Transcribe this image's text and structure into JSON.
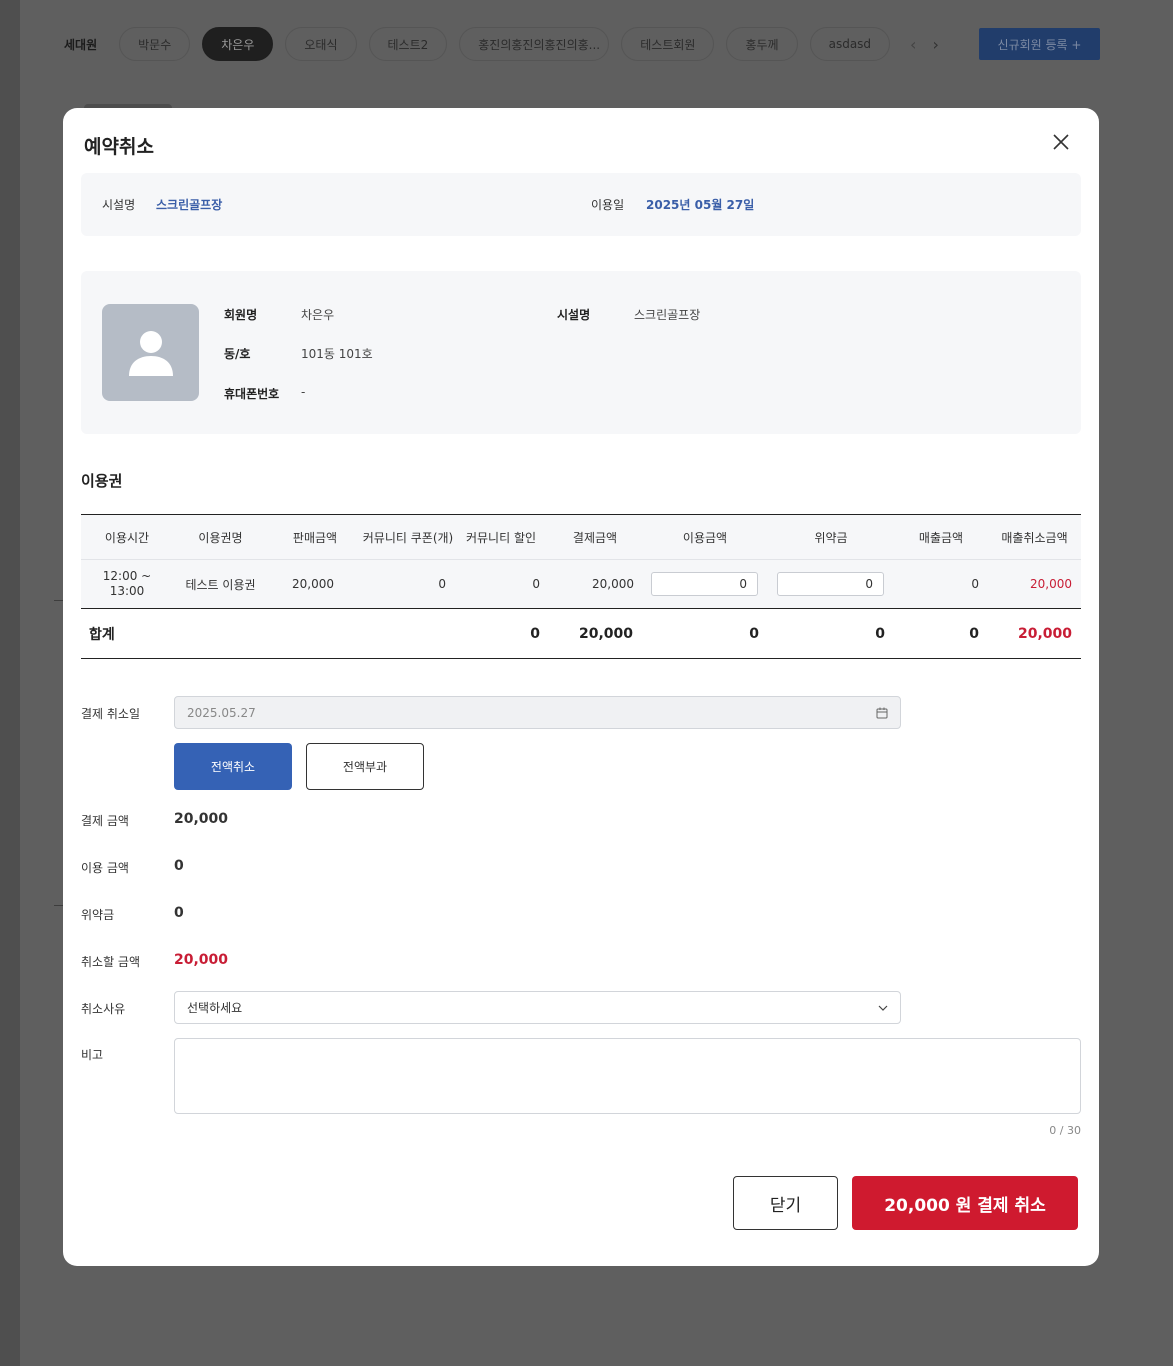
{
  "background": {
    "member_bar_label": "세대원",
    "members": [
      "박문수",
      "차은우",
      "오태식",
      "테스트2",
      "홍진의홍진의홍진의홍...",
      "테스트회원",
      "홍두께",
      "asdasd"
    ],
    "active_member_index": 1,
    "new_member_button": "신규회원 등록  +"
  },
  "modal": {
    "title": "예약취소",
    "info": {
      "facility_label": "시설명",
      "facility_value": "스크린골프장",
      "date_label": "이용일",
      "date_value": "2025년 05월 27일"
    },
    "member": {
      "name_label": "회원명",
      "name_value": "차은우",
      "unit_label": "동/호",
      "unit_value": "101동 101호",
      "phone_label": "휴대폰번호",
      "phone_value": "-",
      "facility_label": "시설명",
      "facility_value": "스크린골프장"
    },
    "ticket_section_title": "이용권",
    "table": {
      "headers": [
        "이용시간",
        "이용권명",
        "판매금액",
        "커뮤니티 쿠폰(개)",
        "커뮤니티 할인",
        "결제금액",
        "이용금액",
        "위약금",
        "매출금액",
        "매출취소금액"
      ],
      "row": {
        "time": "12:00 ~ 13:00",
        "ticket_name": "테스트 이용권",
        "sale_amount": "20,000",
        "coupon_count": "0",
        "community_discount": "0",
        "payment_amount": "20,000",
        "usage_amount": "0",
        "penalty": "0",
        "sales_amount": "0",
        "sales_cancel_amount": "20,000"
      },
      "total": {
        "label": "합계",
        "community_discount": "0",
        "payment_amount": "20,000",
        "usage_amount": "0",
        "penalty": "0",
        "sales_amount": "0",
        "sales_cancel_amount": "20,000"
      }
    },
    "form": {
      "cancel_date_label": "결제 취소일",
      "cancel_date_value": "2025.05.27",
      "full_cancel_button": "전액취소",
      "full_charge_button": "전액부과",
      "payment_label": "결제 금액",
      "payment_value": "20,000",
      "usage_label": "이용 금액",
      "usage_value": "0",
      "penalty_label": "위약금",
      "penalty_value": "0",
      "cancel_amount_label": "취소할 금액",
      "cancel_amount_value": "20,000",
      "reason_label": "취소사유",
      "reason_placeholder": "선택하세요",
      "memo_label": "비고",
      "memo_value": "",
      "memo_counter": "0 / 30"
    },
    "buttons": {
      "close": "닫기",
      "submit": "20,000 원 결제 취소"
    }
  },
  "colors": {
    "accent_blue": "#3562b5",
    "danger_red": "#cf1a2f",
    "link_blue": "#3a5ea8"
  }
}
